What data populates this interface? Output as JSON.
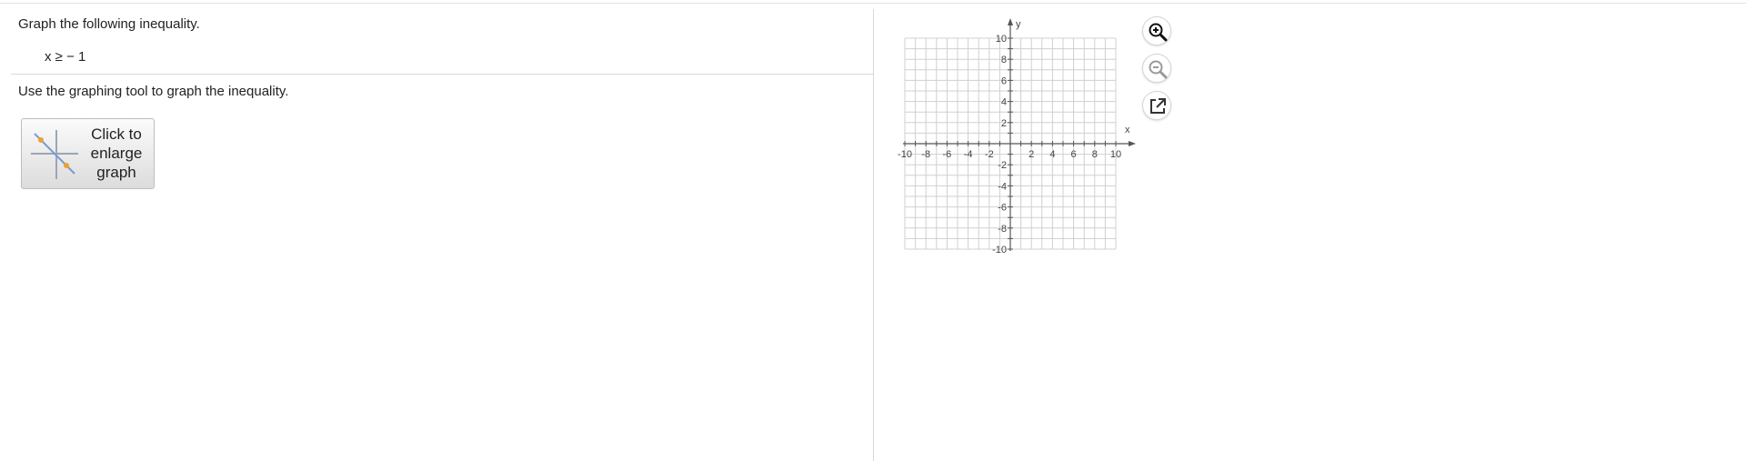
{
  "question": {
    "instruction": "Graph the following inequality.",
    "inequality": "x ≥ − 1",
    "tool_instruction": "Use the graphing tool to graph the inequality."
  },
  "enlarge_button": {
    "label": "Click to\nenlarge\ngraph"
  },
  "graph": {
    "x_axis_label": "x",
    "y_axis_label": "y",
    "x_range": [
      -10,
      10
    ],
    "y_range": [
      -10,
      10
    ],
    "grid_step": 1,
    "x_tick_labels": [
      "-10",
      "-8",
      "-6",
      "-4",
      "-2",
      "2",
      "4",
      "6",
      "8",
      "10"
    ],
    "y_tick_labels": [
      "10",
      "8",
      "6",
      "4",
      "2",
      "-2",
      "-4",
      "-6",
      "-8",
      "-10"
    ]
  },
  "toolbar": {
    "zoom_in": "zoom-in-icon",
    "zoom_out": "zoom-out-icon",
    "popout": "popout-icon"
  }
}
